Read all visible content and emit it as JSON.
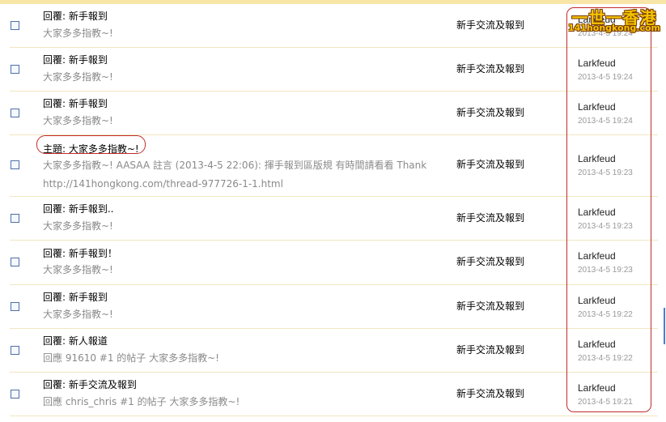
{
  "watermark": {
    "line1": "一世一香港",
    "line2": "141hongkong.com"
  },
  "rows": [
    {
      "title": "回覆: 新手報到",
      "snippet": "大家多多指教~!",
      "forum": "新手交流及報到",
      "author": "Larkfeud",
      "date": "2013-4-5 19:24"
    },
    {
      "title": "回覆: 新手報到",
      "snippet": "大家多多指教~!",
      "forum": "新手交流及報到",
      "author": "Larkfeud",
      "date": "2013-4-5 19:24"
    },
    {
      "title": "回覆: 新手報到",
      "snippet": "大家多多指教~!",
      "forum": "新手交流及報到",
      "author": "Larkfeud",
      "date": "2013-4-5 19:24"
    },
    {
      "title": "主題: 大家多多指教~!",
      "snippet": "大家多多指教~! AASAA 註言 (2013-4-5 22:06): 揮手報到區版規 有時間請看看 Thank http://141hongkong.com/thread-977726-1-1.html",
      "forum": "新手交流及報到",
      "author": "Larkfeud",
      "date": "2013-4-5 19:23"
    },
    {
      "title": "回覆: 新手報到..",
      "snippet": "大家多多指教~!",
      "forum": "新手交流及報到",
      "author": "Larkfeud",
      "date": "2013-4-5 19:23"
    },
    {
      "title": "回覆: 新手報到！",
      "snippet": "大家多多指教~!",
      "forum": "新手交流及報到",
      "author": "Larkfeud",
      "date": "2013-4-5 19:23"
    },
    {
      "title": "回覆: 新手報到",
      "snippet": "大家多多指教~!",
      "forum": "新手交流及報到",
      "author": "Larkfeud",
      "date": "2013-4-5 19:22"
    },
    {
      "title": "回覆: 新人報道",
      "snippet": "回應 91610 #1 的帖子 大家多多指教~!",
      "forum": "新手交流及報到",
      "author": "Larkfeud",
      "date": "2013-4-5 19:22"
    },
    {
      "title": "回覆: 新手交流及報到",
      "snippet": "回應 chris_chris #1 的帖子 大家多多指教~!",
      "forum": "新手交流及報到",
      "author": "Larkfeud",
      "date": "2013-4-5 19:21"
    }
  ]
}
